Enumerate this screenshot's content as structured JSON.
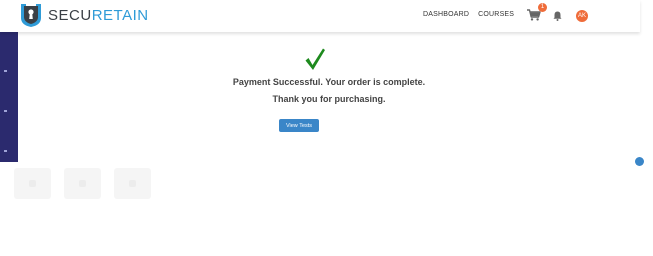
{
  "brand": {
    "part1": "SECU",
    "part2": "RETAIN"
  },
  "nav": {
    "dashboard": "DASHBOARD",
    "courses": "COURSES"
  },
  "cart": {
    "count": "1"
  },
  "user": {
    "initials": "AK"
  },
  "main": {
    "success_line1": "Payment Successful. Your order is complete.",
    "success_line2": "Thank you for purchasing.",
    "view_button": "View Tests"
  },
  "icons": {
    "logo": "shield-keyhole-icon",
    "cart": "cart-icon",
    "bell": "bell-icon",
    "success": "checkmark-icon"
  },
  "colors": {
    "brand_accent": "#2f9bd7",
    "sidebar": "#2b2a6e",
    "badge": "#ef6c3a",
    "button": "#3a86c8",
    "check": "#1e8a1e"
  }
}
